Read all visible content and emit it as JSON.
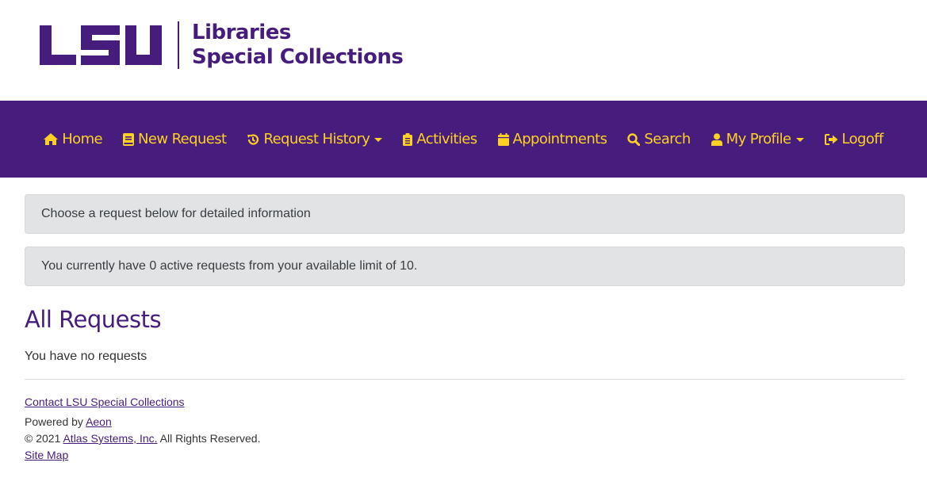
{
  "header": {
    "logo_mark": "LSU",
    "logo_line1": "Libraries",
    "logo_line2": "Special Collections"
  },
  "colors": {
    "brand_purple": "#461d7c",
    "brand_gold": "#fdd023",
    "alert_bg": "#e2e3e5"
  },
  "nav": {
    "items": [
      {
        "label": "Home",
        "icon": "home-icon",
        "dropdown": false
      },
      {
        "label": "New Request",
        "icon": "book-icon",
        "dropdown": false
      },
      {
        "label": "Request History",
        "icon": "history-icon",
        "dropdown": true
      },
      {
        "label": "Activities",
        "icon": "clipboard-icon",
        "dropdown": false
      },
      {
        "label": "Appointments",
        "icon": "calendar-icon",
        "dropdown": false
      },
      {
        "label": "Search",
        "icon": "search-icon",
        "dropdown": false
      },
      {
        "label": "My Profile",
        "icon": "user-icon",
        "dropdown": true
      },
      {
        "label": "Logoff",
        "icon": "sign-out-icon",
        "dropdown": false
      }
    ]
  },
  "alerts": {
    "choose": "Choose a request below for detailed information",
    "limit": "You currently have 0 active requests from your available limit of 10."
  },
  "main": {
    "title": "All Requests",
    "empty_message": "You have no requests"
  },
  "footer": {
    "contact_link": "Contact LSU Special Collections",
    "powered_by": "Powered by ",
    "aeon_link": "Aeon",
    "copyright_prefix": "© 2021 ",
    "atlas_link": "Atlas Systems, Inc.",
    "copyright_suffix": " All Rights Reserved.",
    "sitemap_link": "Site Map"
  }
}
